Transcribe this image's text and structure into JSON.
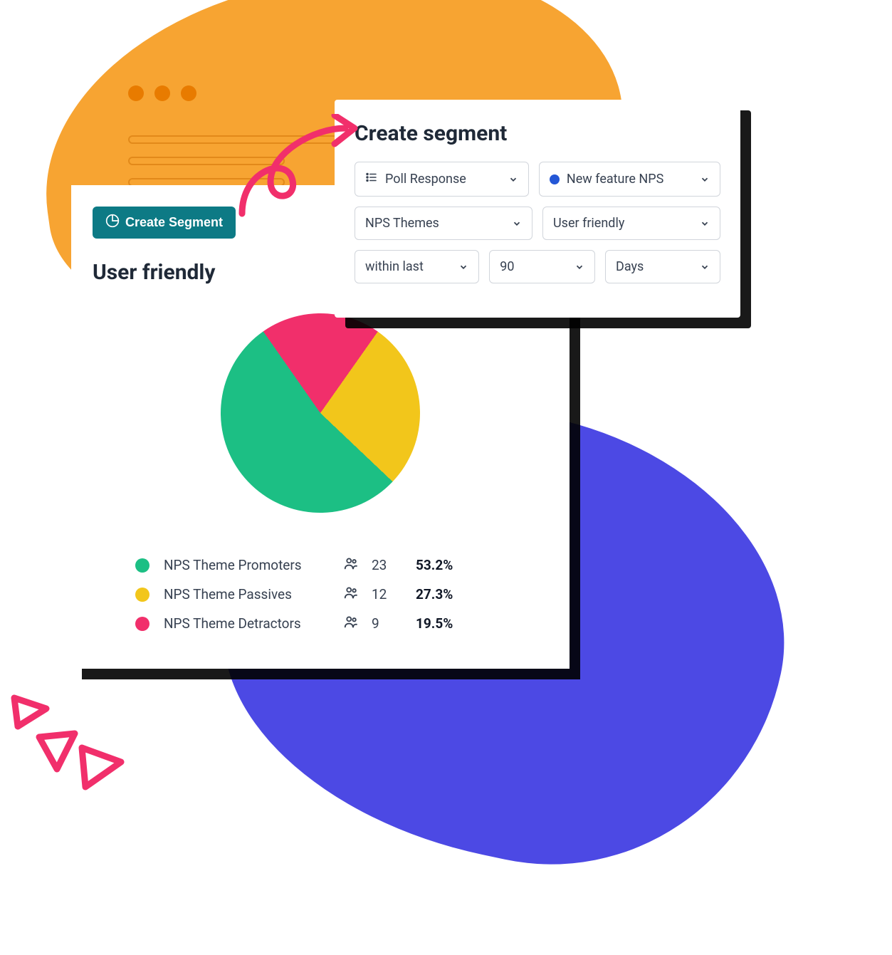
{
  "chart_data": {
    "type": "pie",
    "title": "User friendly",
    "series": [
      {
        "name": "NPS Theme Promoters",
        "count": 23,
        "percent": 53.2,
        "color": "#1CBF84"
      },
      {
        "name": "NPS Theme Passives",
        "count": 12,
        "percent": 27.3,
        "color": "#F2C61B"
      },
      {
        "name": "NPS Theme Detractors",
        "count": 9,
        "percent": 19.5,
        "color": "#F12F6B"
      }
    ]
  },
  "main_card": {
    "button_label": "Create Segment",
    "title": "User friendly"
  },
  "legend": [
    {
      "label": "NPS Theme Promoters",
      "count": "23",
      "pct": "53.2%",
      "color": "#1CBF84"
    },
    {
      "label": "NPS Theme Passives",
      "count": "12",
      "pct": "27.3%",
      "color": "#F2C61B"
    },
    {
      "label": "NPS Theme Detractors",
      "count": "9",
      "pct": "19.5%",
      "color": "#F12F6B"
    }
  ],
  "panel": {
    "title": "Create segment",
    "row1": {
      "left": "Poll Response",
      "right": "New feature NPS"
    },
    "row2": {
      "left": "NPS Themes",
      "right": "User friendly"
    },
    "row3": {
      "a": "within last",
      "b": "90",
      "c": "Days"
    }
  },
  "colors": {
    "promoters": "#1CBF84",
    "passives": "#F2C61B",
    "detractors": "#F12F6B",
    "teal": "#0D7A85",
    "orange": "#F7A432",
    "indigo": "#4C49E4",
    "pink": "#F12F6B"
  }
}
